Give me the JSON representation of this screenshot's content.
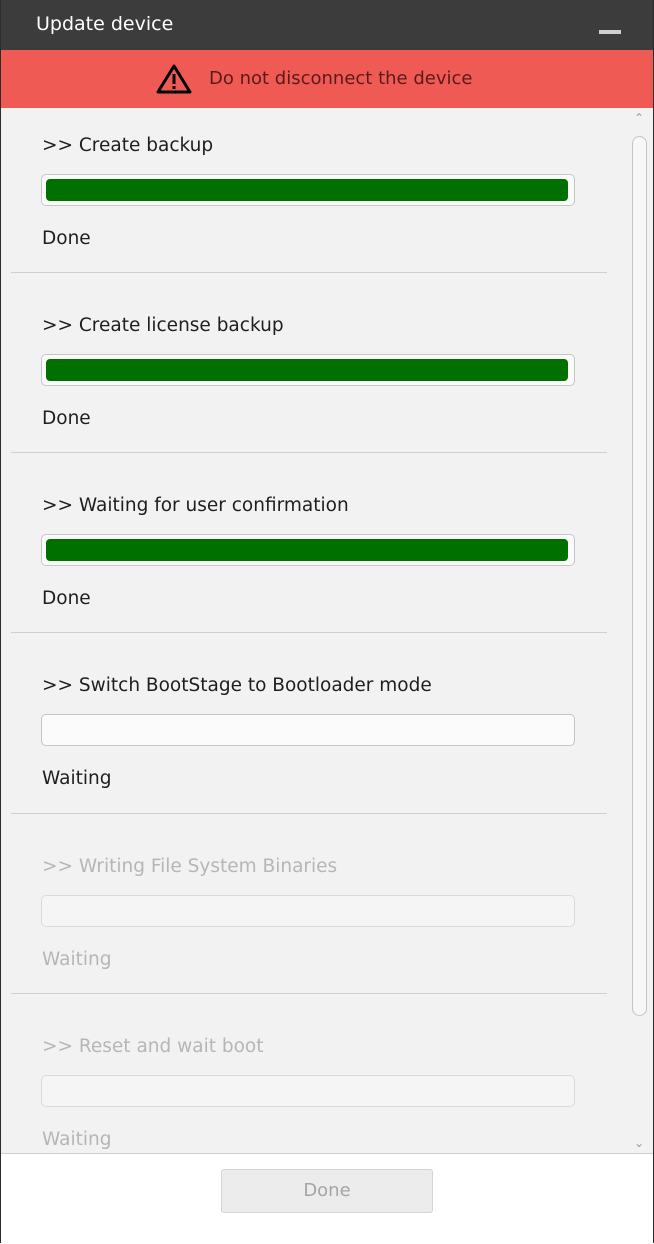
{
  "window": {
    "title": "Update device"
  },
  "warning": {
    "text": "Do not disconnect the device",
    "icon": "warning-triangle-icon"
  },
  "steps": [
    {
      "title": ">> Create backup",
      "status": "Done",
      "progress": 1.0,
      "enabled": true
    },
    {
      "title": ">> Create license backup",
      "status": "Done",
      "progress": 1.0,
      "enabled": true
    },
    {
      "title": ">> Waiting for user confirmation",
      "status": "Done",
      "progress": 1.0,
      "enabled": true
    },
    {
      "title": ">> Switch BootStage to Bootloader mode",
      "status": "Waiting",
      "progress": 0,
      "enabled": true
    },
    {
      "title": ">> Writing File System Binaries",
      "status": "Waiting",
      "progress": 0,
      "enabled": false
    },
    {
      "title": ">> Reset and wait boot",
      "status": "Waiting",
      "progress": 0,
      "enabled": false
    }
  ],
  "footer": {
    "done_label": "Done",
    "done_enabled": false
  },
  "colors": {
    "title_bar": "#3c3c3c",
    "warning_banner": "#f05a55",
    "progress_fill": "#007000"
  }
}
